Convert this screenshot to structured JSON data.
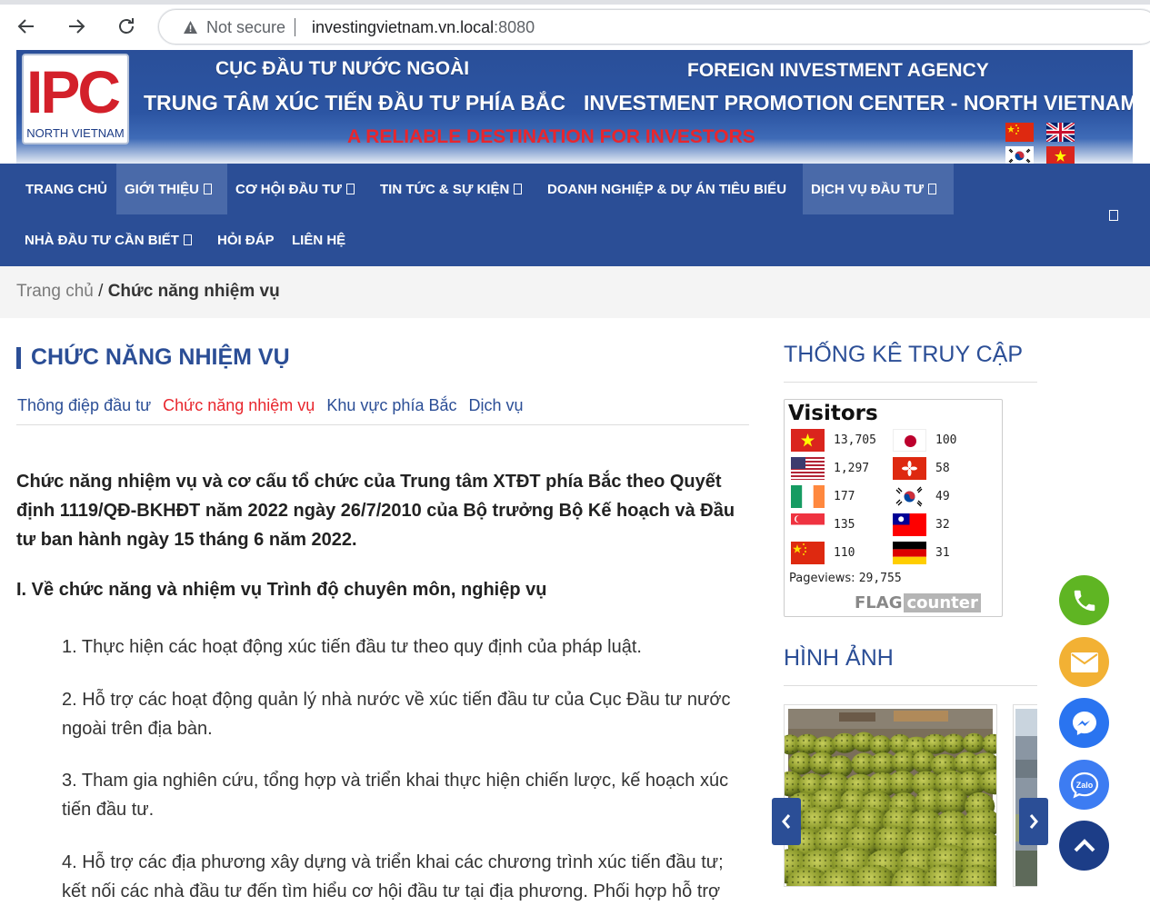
{
  "browser": {
    "security": "Not secure",
    "url_host": "investingvietnam.vn.local",
    "url_port": ":8080"
  },
  "header": {
    "logo_text": "IPC",
    "logo_sub": "NORTH VIETNAM",
    "agency_vn": "CỤC ĐẦU TƯ NƯỚC NGOÀI",
    "center_vn": "TRUNG TÂM XÚC TIẾN ĐẦU TƯ PHÍA BẮC",
    "agency_en": "FOREIGN INVESTMENT AGENCY",
    "center_en": "INVESTMENT PROMOTION CENTER - NORTH VIETNAM",
    "slogan": "A RELIABLE DESTINATION FOR INVESTORS",
    "languages": [
      "china-flag-icon",
      "uk-flag-icon",
      "korea-flag-icon",
      "vietnam-flag-icon"
    ]
  },
  "nav": {
    "items": [
      {
        "label": "TRANG CHỦ"
      },
      {
        "label": "GIỚI THIỆU"
      },
      {
        "label": "CƠ HỘI ĐẦU TƯ"
      },
      {
        "label": "TIN TỨC & SỰ KIỆN"
      },
      {
        "label": "DOANH NGHIỆP & DỰ ÁN TIÊU BIỂU"
      },
      {
        "label": "DỊCH VỤ ĐẦU TƯ"
      },
      {
        "label": "NHÀ ĐẦU TƯ CẦN BIẾT"
      },
      {
        "label": "HỎI ĐÁP"
      },
      {
        "label": "LIÊN HỆ"
      }
    ]
  },
  "breadcrumb": {
    "home": "Trang chủ",
    "separator": "/",
    "current": "Chức năng nhiệm vụ"
  },
  "main": {
    "title": "CHỨC NĂNG NHIỆM VỤ",
    "subnav": [
      {
        "label": "Thông điệp đầu tư"
      },
      {
        "label": "Chức năng nhiệm vụ"
      },
      {
        "label": "Khu vực phía Bắc"
      },
      {
        "label": "Dịch vụ"
      }
    ],
    "intro": "Chức năng nhiệm vụ và cơ cấu tổ chức của Trung tâm XTĐT phía Bắc theo Quyết định 1119/QĐ-BKHĐT năm 2022 ngày 26/7/2010 của Bộ trưởng Bộ Kế hoạch và Đầu tư ban hành ngày 15 tháng 6 năm 2022.",
    "section_heading": "I. Về chức năng và nhiệm vụ Trình độ chuyên môn, nghiệp vụ",
    "items": [
      "1.  Thực hiện các hoạt động xúc tiến đầu tư theo quy định của pháp luật.",
      "2.  Hỗ trợ các hoạt động quản lý nhà nước về xúc tiến đầu tư của Cục Đầu tư nước ngoài trên địa bàn.",
      "3.  Tham gia nghiên cứu, tổng hợp và triển khai thực hiện chiến lược, kế hoạch xúc tiến đầu tư.",
      "4.  Hỗ trợ các địa phương xây dựng và triển khai các chương trình xúc tiến đầu tư; kết nối các nhà đầu tư đến tìm hiểu cơ hội đầu tư tại địa phương. Phối hợp hỗ trợ"
    ]
  },
  "sidebar": {
    "stats_title": "THỐNG KÊ TRUY CẬP",
    "counter": {
      "heading": "Visitors",
      "rows": [
        {
          "flag": "vietnam-flag-icon",
          "count": "13,705"
        },
        {
          "flag": "japan-flag-icon",
          "count": "100"
        },
        {
          "flag": "usa-flag-icon",
          "count": "1,297"
        },
        {
          "flag": "hongkong-flag-icon",
          "count": "58"
        },
        {
          "flag": "ireland-flag-icon",
          "count": "177"
        },
        {
          "flag": "korea-flag-icon",
          "count": "49"
        },
        {
          "flag": "singapore-flag-icon",
          "count": "135"
        },
        {
          "flag": "taiwan-flag-icon",
          "count": "32"
        },
        {
          "flag": "china-flag-icon",
          "count": "110"
        },
        {
          "flag": "germany-flag-icon",
          "count": "31"
        }
      ],
      "pageviews_label": "Pageviews:",
      "pageviews_value": "29,755",
      "brand_flag": "FLAG",
      "brand_counter": "counter"
    },
    "gallery_title": "HÌNH ẢNH"
  },
  "colors": {
    "primary": "#2b4e96",
    "accent_red": "#e8262d",
    "phone": "#5fb523",
    "email": "#f2b134",
    "messenger": "#2a74f0",
    "zalo": "#3d7cf2",
    "scroll_top": "#1c3d87"
  }
}
